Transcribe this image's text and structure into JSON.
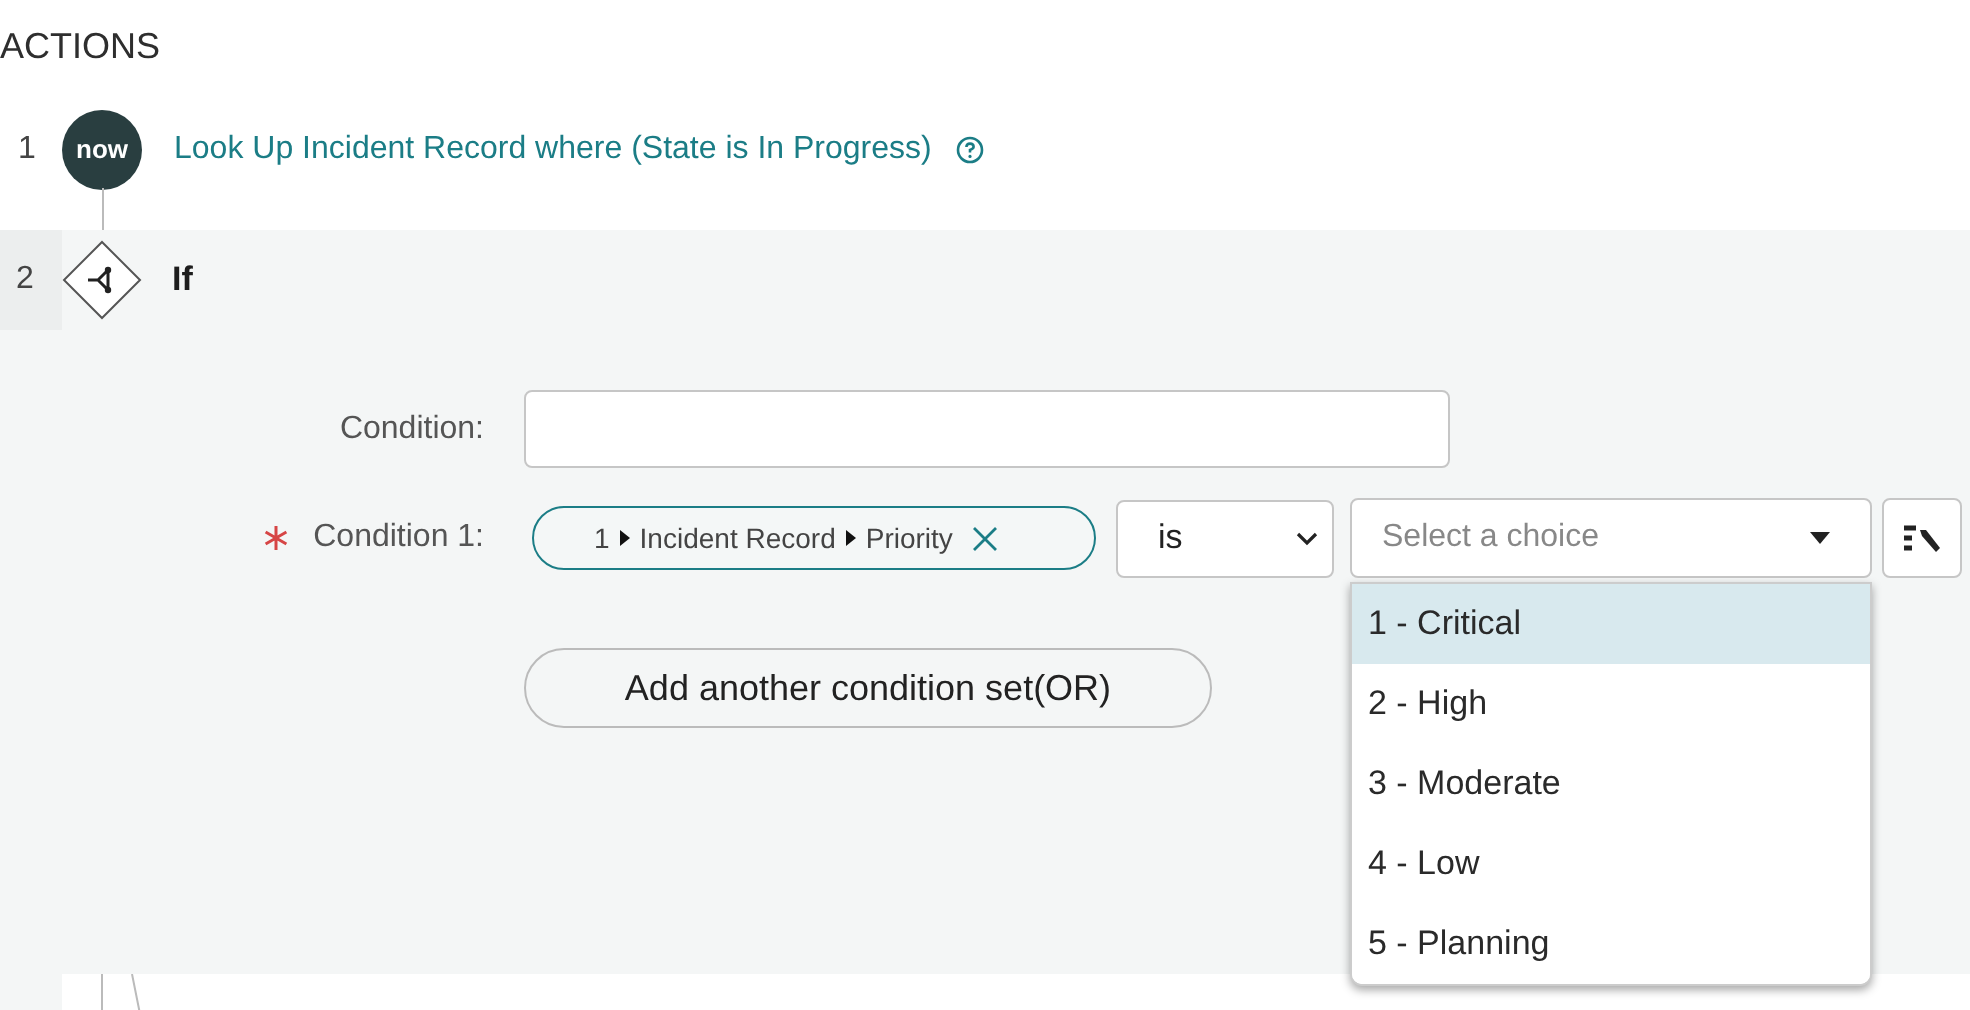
{
  "section_title": "ACTIONS",
  "steps": [
    {
      "number": "1",
      "kind": "action",
      "logo_text": "now",
      "label": "Look Up Incident Record where (State is In Progress)"
    },
    {
      "number": "2",
      "kind": "if",
      "label": "If"
    }
  ],
  "condition": {
    "label": "Condition:"
  },
  "condition_rows": [
    {
      "label": "Condition 1:",
      "required": true,
      "pill": [
        "1",
        "Incident Record",
        "Priority"
      ],
      "operator": "is",
      "choice_placeholder": "Select a choice"
    }
  ],
  "add_button": "Add another condition set(OR)",
  "choices": [
    {
      "label": "1 - Critical",
      "selected": true
    },
    {
      "label": "2 - High",
      "selected": false
    },
    {
      "label": "3 - Moderate",
      "selected": false
    },
    {
      "label": "4 - Low",
      "selected": false
    },
    {
      "label": "5 - Planning",
      "selected": false
    }
  ]
}
